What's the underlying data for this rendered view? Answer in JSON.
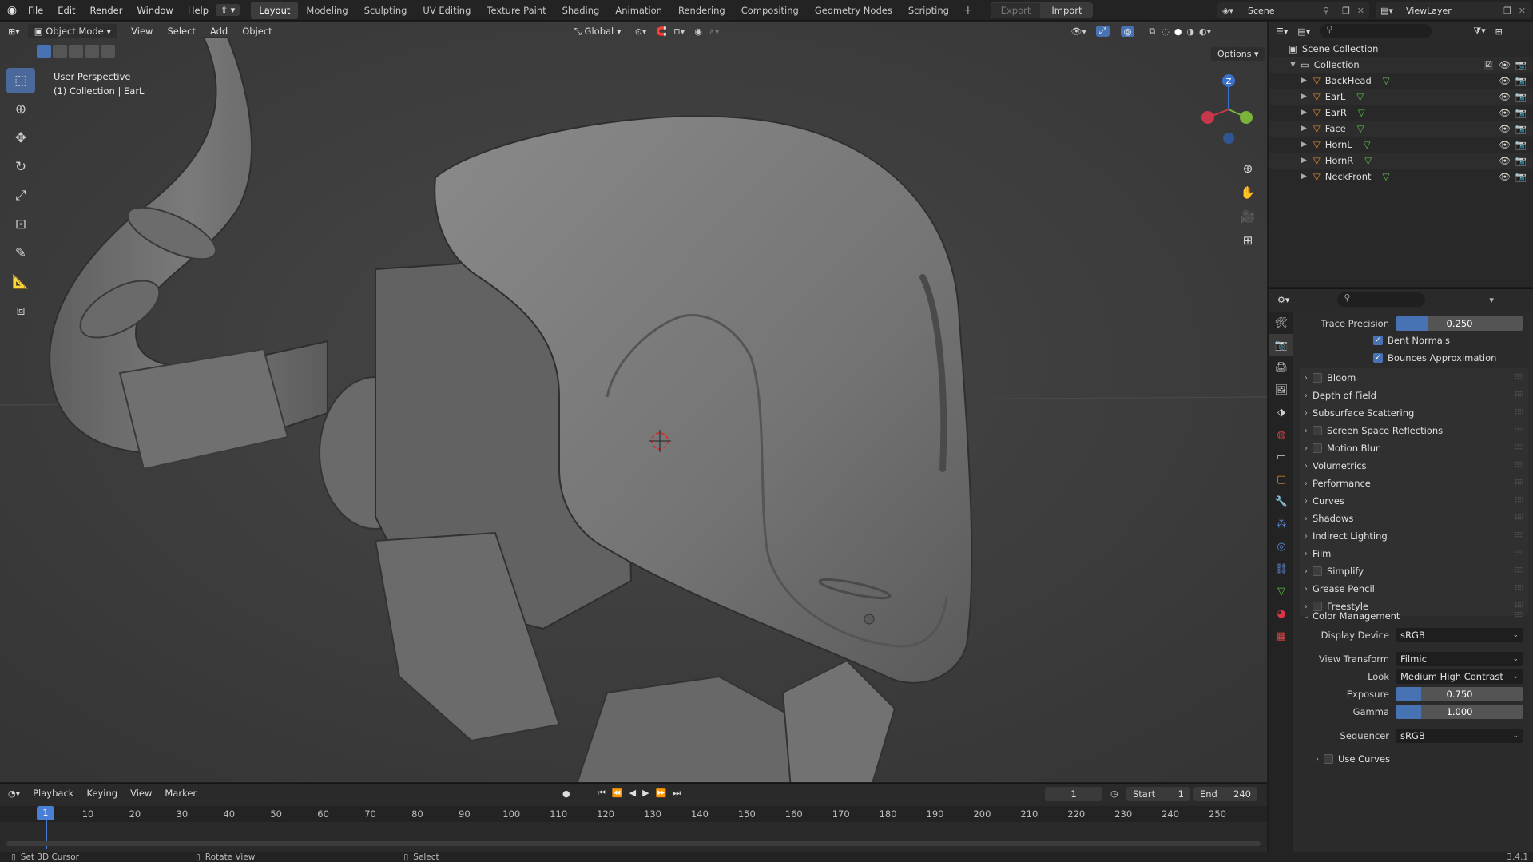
{
  "topbar": {
    "menu": [
      "File",
      "Edit",
      "Render",
      "Window",
      "Help"
    ],
    "workspaces": [
      "Layout",
      "Modeling",
      "Sculpting",
      "UV Editing",
      "Texture Paint",
      "Shading",
      "Animation",
      "Rendering",
      "Compositing",
      "Geometry Nodes",
      "Scripting"
    ],
    "active_workspace": "Layout",
    "add_workspace": "+",
    "export_label": "Export",
    "import_label": "Import",
    "scene_name": "Scene",
    "view_layer": "ViewLayer"
  },
  "viewport": {
    "mode": "Object Mode",
    "menus": [
      "View",
      "Select",
      "Add",
      "Object"
    ],
    "orientation": "Global",
    "options_label": "Options",
    "overlay_line1": "User Perspective",
    "overlay_line2": "(1) Collection | EarL",
    "gizmo_axes": {
      "z": "Z",
      "x_color": "#c8384a",
      "y_color": "#7ab33a",
      "z_color": "#3b72cf"
    }
  },
  "outliner": {
    "root": "Scene Collection",
    "collection": "Collection",
    "objects": [
      "BackHead",
      "EarL",
      "EarR",
      "Face",
      "HornL",
      "HornR",
      "NeckFront"
    ]
  },
  "properties": {
    "trace_precision_label": "Trace Precision",
    "trace_precision_value": "0.250",
    "trace_precision_fraction": 0.25,
    "bent_normals": "Bent Normals",
    "bounces_approx": "Bounces Approximation",
    "panels": [
      {
        "label": "Bloom",
        "checkbox": true
      },
      {
        "label": "Depth of Field",
        "checkbox": false
      },
      {
        "label": "Subsurface Scattering",
        "checkbox": false
      },
      {
        "label": "Screen Space Reflections",
        "checkbox": true
      },
      {
        "label": "Motion Blur",
        "checkbox": true
      },
      {
        "label": "Volumetrics",
        "checkbox": false
      },
      {
        "label": "Performance",
        "checkbox": false
      },
      {
        "label": "Curves",
        "checkbox": false
      },
      {
        "label": "Shadows",
        "checkbox": false
      },
      {
        "label": "Indirect Lighting",
        "checkbox": false
      },
      {
        "label": "Film",
        "checkbox": false
      },
      {
        "label": "Simplify",
        "checkbox": true
      },
      {
        "label": "Grease Pencil",
        "checkbox": false
      },
      {
        "label": "Freestyle",
        "checkbox": true
      }
    ],
    "color_management": {
      "title": "Color Management",
      "display_device_label": "Display Device",
      "display_device": "sRGB",
      "view_transform_label": "View Transform",
      "view_transform": "Filmic",
      "look_label": "Look",
      "look": "Medium High Contrast",
      "exposure_label": "Exposure",
      "exposure": "0.750",
      "exposure_fraction": 0.2,
      "gamma_label": "Gamma",
      "gamma": "1.000",
      "gamma_fraction": 0.2,
      "sequencer_label": "Sequencer",
      "sequencer": "sRGB",
      "use_curves": "Use Curves"
    }
  },
  "timeline": {
    "menus": [
      "Playback",
      "Keying",
      "View",
      "Marker"
    ],
    "current_frame": "1",
    "start_label": "Start",
    "start": "1",
    "end_label": "End",
    "end": "240",
    "ruler": [
      "1",
      "10",
      "20",
      "30",
      "40",
      "50",
      "60",
      "70",
      "80",
      "90",
      "100",
      "110",
      "120",
      "130",
      "140",
      "150",
      "160",
      "170",
      "180",
      "190",
      "200",
      "210",
      "220",
      "230",
      "240",
      "250"
    ]
  },
  "statusbar": {
    "left": "Set 3D Cursor",
    "middle": "Rotate View",
    "right": "Select",
    "version": "3.4.1"
  }
}
